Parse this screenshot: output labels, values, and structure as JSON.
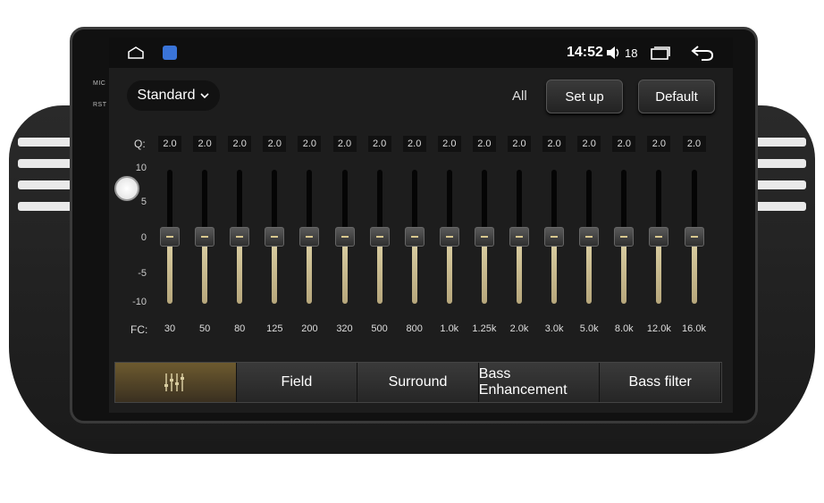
{
  "status": {
    "time": "14:52",
    "volume": "18"
  },
  "side_labels": [
    "MIC",
    "RST"
  ],
  "preset": {
    "label": "Standard",
    "chevron": "chevron-down-icon"
  },
  "top_controls": {
    "all": "All",
    "setup": "Set up",
    "default": "Default"
  },
  "eq": {
    "q_label": "Q:",
    "fc_label": "FC:",
    "scale": [
      "10",
      "5",
      "0",
      "-5",
      "-10"
    ],
    "bands": [
      {
        "q": "2.0",
        "fc": "30",
        "gain": 0
      },
      {
        "q": "2.0",
        "fc": "50",
        "gain": 0
      },
      {
        "q": "2.0",
        "fc": "80",
        "gain": 0
      },
      {
        "q": "2.0",
        "fc": "125",
        "gain": 0
      },
      {
        "q": "2.0",
        "fc": "200",
        "gain": 0
      },
      {
        "q": "2.0",
        "fc": "320",
        "gain": 0
      },
      {
        "q": "2.0",
        "fc": "500",
        "gain": 0
      },
      {
        "q": "2.0",
        "fc": "800",
        "gain": 0
      },
      {
        "q": "2.0",
        "fc": "1.0k",
        "gain": 0
      },
      {
        "q": "2.0",
        "fc": "1.25k",
        "gain": 0
      },
      {
        "q": "2.0",
        "fc": "2.0k",
        "gain": 0
      },
      {
        "q": "2.0",
        "fc": "3.0k",
        "gain": 0
      },
      {
        "q": "2.0",
        "fc": "5.0k",
        "gain": 0
      },
      {
        "q": "2.0",
        "fc": "8.0k",
        "gain": 0
      },
      {
        "q": "2.0",
        "fc": "12.0k",
        "gain": 0
      },
      {
        "q": "2.0",
        "fc": "16.0k",
        "gain": 0
      }
    ]
  },
  "tabs": [
    {
      "label": "",
      "icon": "equalizer-icon",
      "active": true
    },
    {
      "label": "Field",
      "active": false
    },
    {
      "label": "Surround",
      "active": false
    },
    {
      "label": "Bass Enhancement",
      "active": false
    },
    {
      "label": "Bass filter",
      "active": false
    }
  ],
  "colors": {
    "accent": "#d8cca0",
    "active_tab": "#6d5a2f"
  }
}
